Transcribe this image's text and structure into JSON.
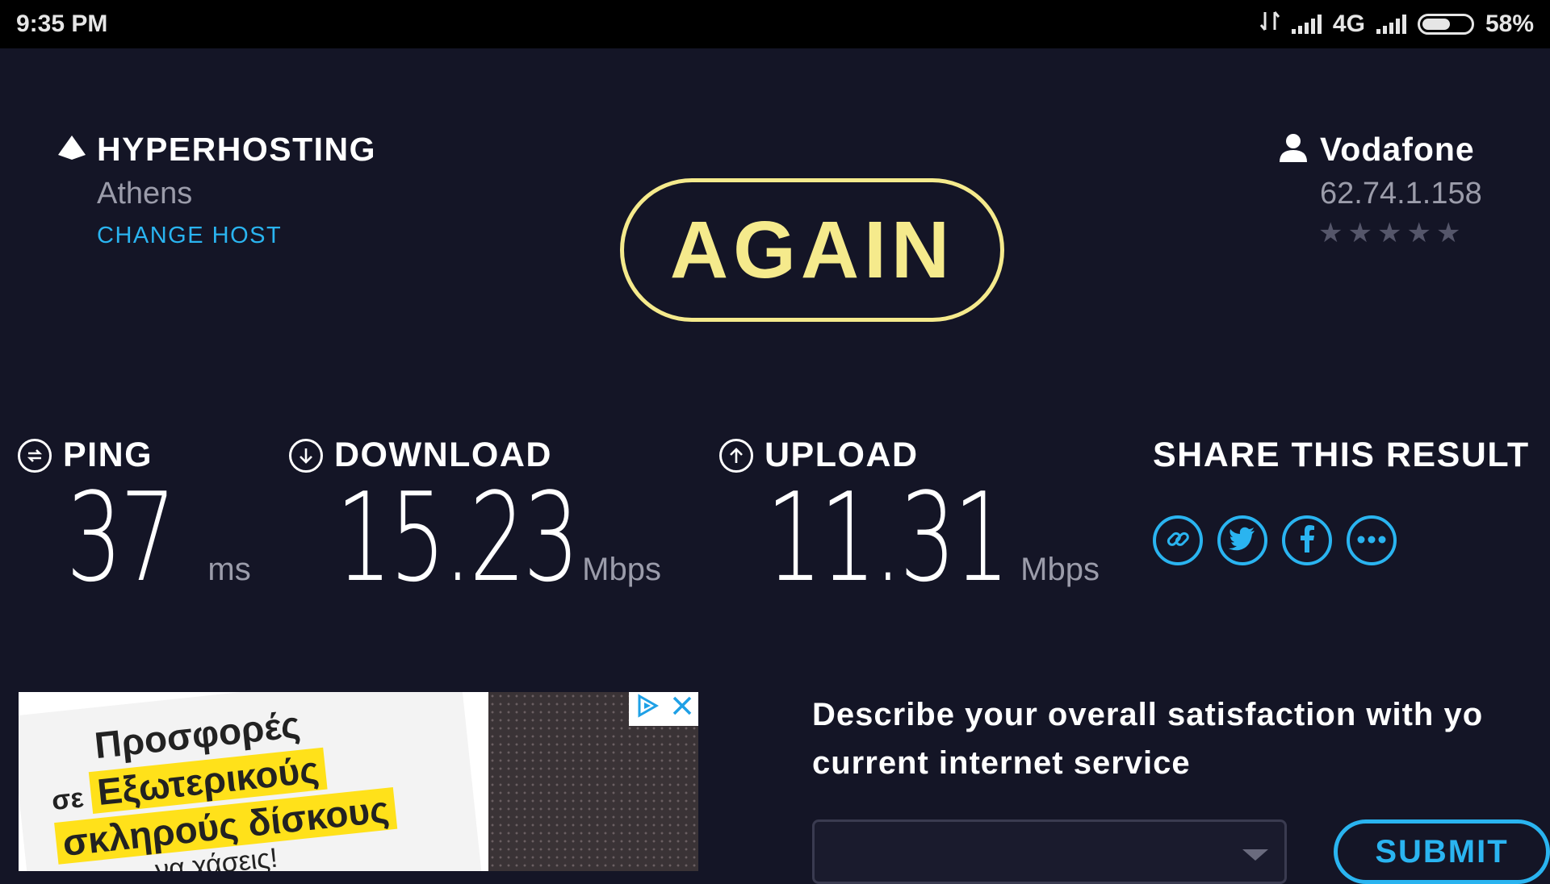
{
  "status_bar": {
    "time": "9:35 PM",
    "network": "4G",
    "battery": "58%",
    "battery_level": 0.58
  },
  "host": {
    "name": "HYPERHOSTING",
    "city": "Athens",
    "change_label": "CHANGE HOST",
    "icon": "triangle-host-icon"
  },
  "isp": {
    "name": "Vodafone",
    "ip": "62.74.1.158",
    "rating": 0,
    "rating_max": 5,
    "icon": "user-icon"
  },
  "again_label": "AGAIN",
  "metrics": {
    "ping": {
      "label": "PING",
      "value": "37",
      "unit": "ms",
      "icon": "ping-icon"
    },
    "download": {
      "label": "DOWNLOAD",
      "value": "15.23",
      "unit": "Mbps",
      "icon": "download-icon"
    },
    "upload": {
      "label": "UPLOAD",
      "value": "11.31",
      "unit": "Mbps",
      "icon": "upload-icon"
    }
  },
  "share": {
    "title": "SHARE THIS RESULT",
    "buttons": [
      "link-icon",
      "twitter-icon",
      "facebook-icon",
      "more-icon"
    ]
  },
  "ad": {
    "line1": "Προσφορές",
    "line2_prefix": "σε",
    "line2": "Εξωτερικούς",
    "line3": "σκληρούς δίσκους",
    "line4": "...να χάσεις!"
  },
  "survey": {
    "question": "Describe your overall satisfaction with your current internet service",
    "question_line1": "Describe your overall satisfaction with yo",
    "question_line2": "current internet service",
    "submit_label": "SUBMIT"
  },
  "colors": {
    "background": "#141526",
    "accent_yellow": "#f5ea8c",
    "accent_blue": "#2ab4f0",
    "muted": "#9b9caa"
  }
}
